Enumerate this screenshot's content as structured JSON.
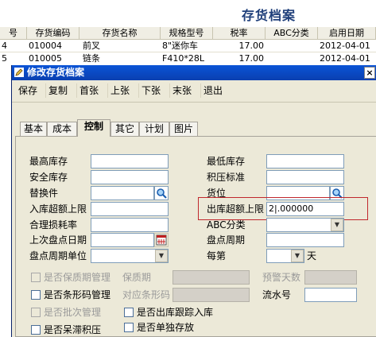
{
  "app_title": "存货档案",
  "grid": {
    "headers": [
      "号",
      "存货编码",
      "存货名称",
      "规格型号",
      "税率",
      "ABC分类",
      "启用日期"
    ],
    "rows": [
      [
        "4",
        "010004",
        "前叉",
        "8\"迷你车",
        "17.00",
        "",
        "2012-04-01"
      ],
      [
        "5",
        "010005",
        "链条",
        "F410*28L",
        "17.00",
        "",
        "2012-04-01"
      ]
    ]
  },
  "dialog": {
    "title": "修改存货档案",
    "close_label": "×",
    "toolbar": [
      "保存",
      "复制",
      "首张",
      "上张",
      "下张",
      "末张",
      "退出"
    ],
    "tabs": [
      "基本",
      "成本",
      "控制",
      "其它",
      "计划",
      "图片"
    ],
    "active_tab": "控制",
    "fields": {
      "max_stock": "最高库存",
      "min_stock": "最低库存",
      "safety_stock": "安全库存",
      "backlog_std": "积压标准",
      "substitute": "替换件",
      "location": "货位",
      "in_over_limit": "入库超额上限",
      "out_over_limit": "出库超额上限",
      "out_over_limit_value": "2|.000000",
      "loss_rate": "合理损耗率",
      "abc_class": "ABC分类",
      "last_check_date": "上次盘点日期",
      "check_cycle": "盘点周期",
      "check_cycle_unit": "盘点周期单位",
      "every": "每第",
      "day_unit": "天",
      "shelf_life_mgmt": "是否保质期管理",
      "shelf_life": "保质期",
      "warning_days": "预警天数",
      "barcode_mgmt": "是否条形码管理",
      "barcode": "对应条形码",
      "serial_no": "流水号",
      "batch_mgmt": "是否批次管理",
      "outbound_trace": "是否出库跟踪入库",
      "stagnant": "是否呆滞积压",
      "separate_storage": "是否单独存放"
    }
  }
}
